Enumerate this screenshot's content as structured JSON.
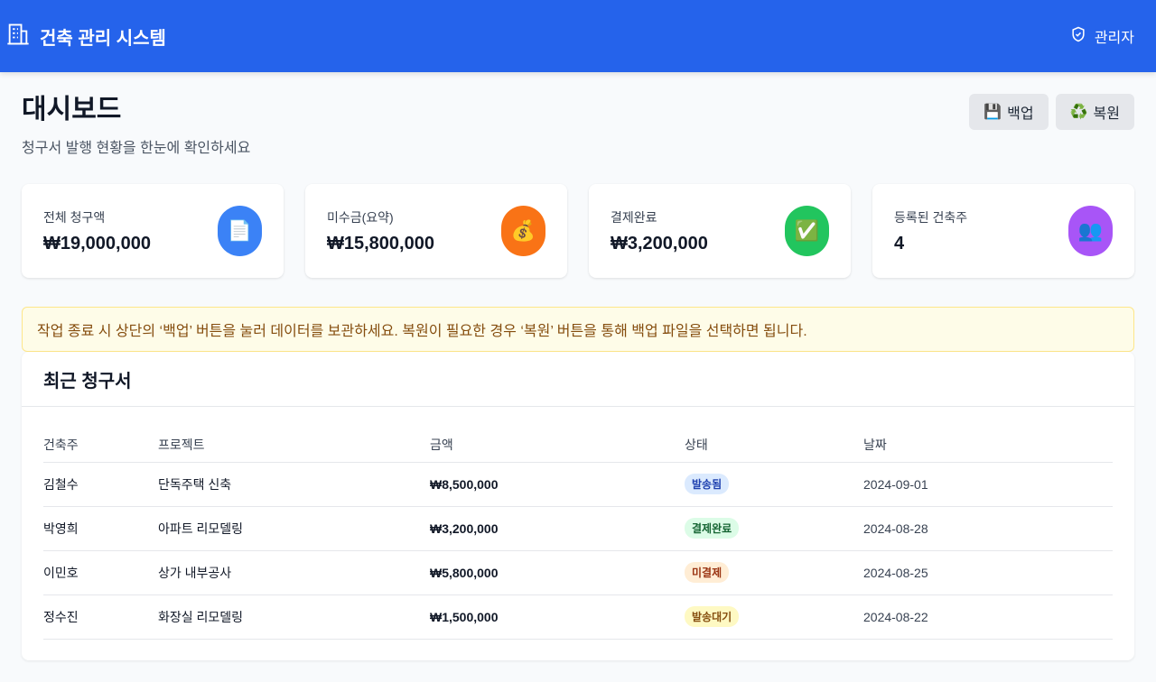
{
  "header": {
    "title": "건축 관리 시스템",
    "admin_label": "관리자",
    "icons": {
      "brand": "building-icon",
      "admin": "shield-check-icon"
    },
    "brand_color": "#2563eb"
  },
  "page": {
    "title": "대시보드",
    "subtitle": "청구서 발행 현황을 한눈에 확인하세요"
  },
  "actions": {
    "backup_icon": "💾",
    "backup_label": "백업",
    "restore_icon": "♻️",
    "restore_label": "복원"
  },
  "stats": [
    {
      "label": "전체 청구액",
      "value": "₩19,000,000",
      "icon": "📄",
      "icon_name": "document-icon",
      "color": "#3b82f6"
    },
    {
      "label": "미수금(요약)",
      "value": "₩15,800,000",
      "icon": "💰",
      "icon_name": "money-bag-icon",
      "color": "#f97316"
    },
    {
      "label": "결제완료",
      "value": "₩3,200,000",
      "icon": "✅",
      "icon_name": "check-mark-icon",
      "color": "#22c55e"
    },
    {
      "label": "등록된 건축주",
      "value": "4",
      "icon": "👥",
      "icon_name": "users-icon",
      "color": "#a855f7"
    }
  ],
  "notice": {
    "text": "작업 종료 시 상단의 ‘백업’ 버튼을 눌러 데이터를 보관하세요. 복원이 필요한 경우 ‘복원’ 버튼을 통해 백업 파일을 선택하면 됩니다."
  },
  "invoices": {
    "title": "최근 청구서",
    "columns": [
      "건축주",
      "프로젝트",
      "금액",
      "상태",
      "날짜"
    ],
    "rows": [
      {
        "owner": "김철수",
        "project": "단독주택 신축",
        "amount": "₩8,500,000",
        "status": "발송됨",
        "date": "2024-09-01"
      },
      {
        "owner": "박영희",
        "project": "아파트 리모델링",
        "amount": "₩3,200,000",
        "status": "결제완료",
        "date": "2024-08-28"
      },
      {
        "owner": "이민호",
        "project": "상가 내부공사",
        "amount": "₩5,800,000",
        "status": "미결제",
        "date": "2024-08-25"
      },
      {
        "owner": "정수진",
        "project": "화장실 리모델링",
        "amount": "₩1,500,000",
        "status": "발송대기",
        "date": "2024-08-22"
      }
    ]
  }
}
